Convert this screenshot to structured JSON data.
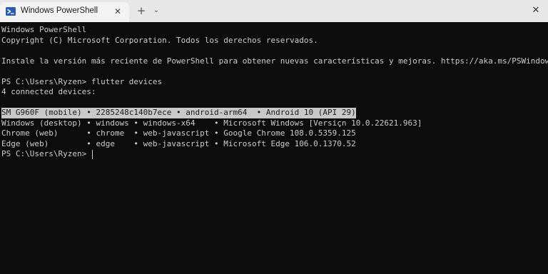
{
  "titlebar": {
    "tab_title": "Windows PowerShell",
    "tab_icon": "powershell-icon",
    "close_tab_icon": "close-icon",
    "new_tab_icon": "plus-icon",
    "dropdown_icon": "chevron-down-icon",
    "window_close_icon": "close-icon",
    "close_tab_glyph": "✕",
    "new_tab_glyph": "+",
    "dropdown_glyph": "⌄",
    "window_close_glyph": "✕"
  },
  "terminal": {
    "lines": [
      "Windows PowerShell",
      "Copyright (C) Microsoft Corporation. Todos los derechos reservados.",
      "",
      "Instale la versión más reciente de PowerShell para obtener nuevas características y mejoras. https://aka.ms/PSWindows",
      "",
      "PS C:\\Users\\Ryzen> flutter devices",
      "4 connected devices:",
      "",
      "SM G960F (mobile) • 2285248c140b7ece • android-arm64  • Android 10 (API 29)",
      "Windows (desktop) • windows • windows-x64    • Microsoft Windows [Versiçn 10.0.22621.963]",
      "Chrome (web)      • chrome  • web-javascript • Google Chrome 108.0.5359.125",
      "Edge (web)        • edge    • web-javascript • Microsoft Edge 106.0.1370.52",
      "PS C:\\Users\\Ryzen> "
    ],
    "selected_line": "SM G960F (mobile) • 2285248c140b7ece • android-arm64  • Android 10 (API 29)"
  },
  "colors": {
    "terminal_bg": "#0c0c0c",
    "terminal_text": "#cccccc",
    "selection_bg": "#c8c8c8",
    "titlebar_bg": "#e7e7e7",
    "tab_bg": "#f3f3f3"
  }
}
